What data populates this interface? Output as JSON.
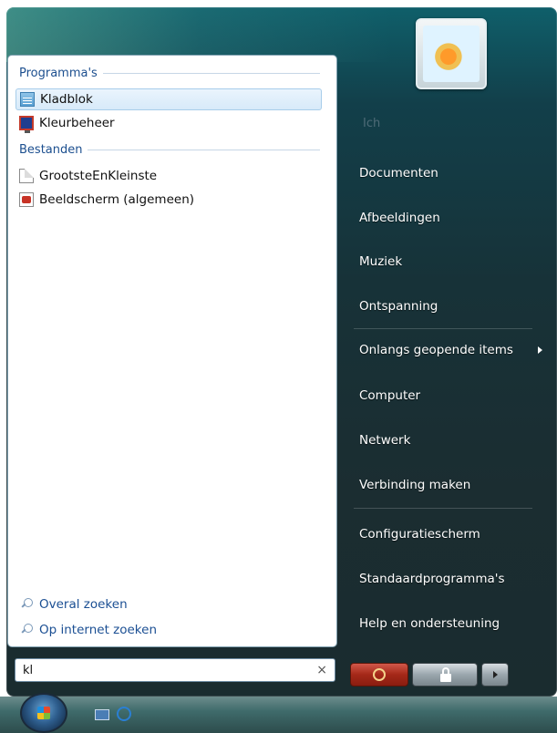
{
  "left_pane": {
    "programs_header": "Programma's",
    "programs": [
      {
        "label": "Kladblok",
        "icon": "notepad-icon",
        "selected": true
      },
      {
        "label": "Kleurbeheer",
        "icon": "color-management-icon",
        "selected": false
      }
    ],
    "files_header": "Bestanden",
    "files": [
      {
        "label": "GrootsteEnKleinste",
        "icon": "text-document-icon"
      },
      {
        "label": "Beeldscherm (algemeen)",
        "icon": "display-settings-icon"
      }
    ],
    "search_links": [
      {
        "label": "Overal zoeken",
        "icon": "search-icon"
      },
      {
        "label": "Op internet zoeken",
        "icon": "search-icon"
      }
    ]
  },
  "search": {
    "value": "kl",
    "clear_label": "×"
  },
  "right_pane": {
    "username": "Ich",
    "items": [
      "Documenten",
      "Afbeeldingen",
      "Muziek",
      "Ontspanning",
      "Onlangs geopende items",
      "Computer",
      "Netwerk",
      "Verbinding maken",
      "Configuratiescherm",
      "Standaardprogramma's",
      "Help en ondersteuning"
    ]
  },
  "colors": {
    "link_blue": "#1b4f93",
    "menu_dark": "#1a2c2f",
    "power_red": "#a42818"
  }
}
